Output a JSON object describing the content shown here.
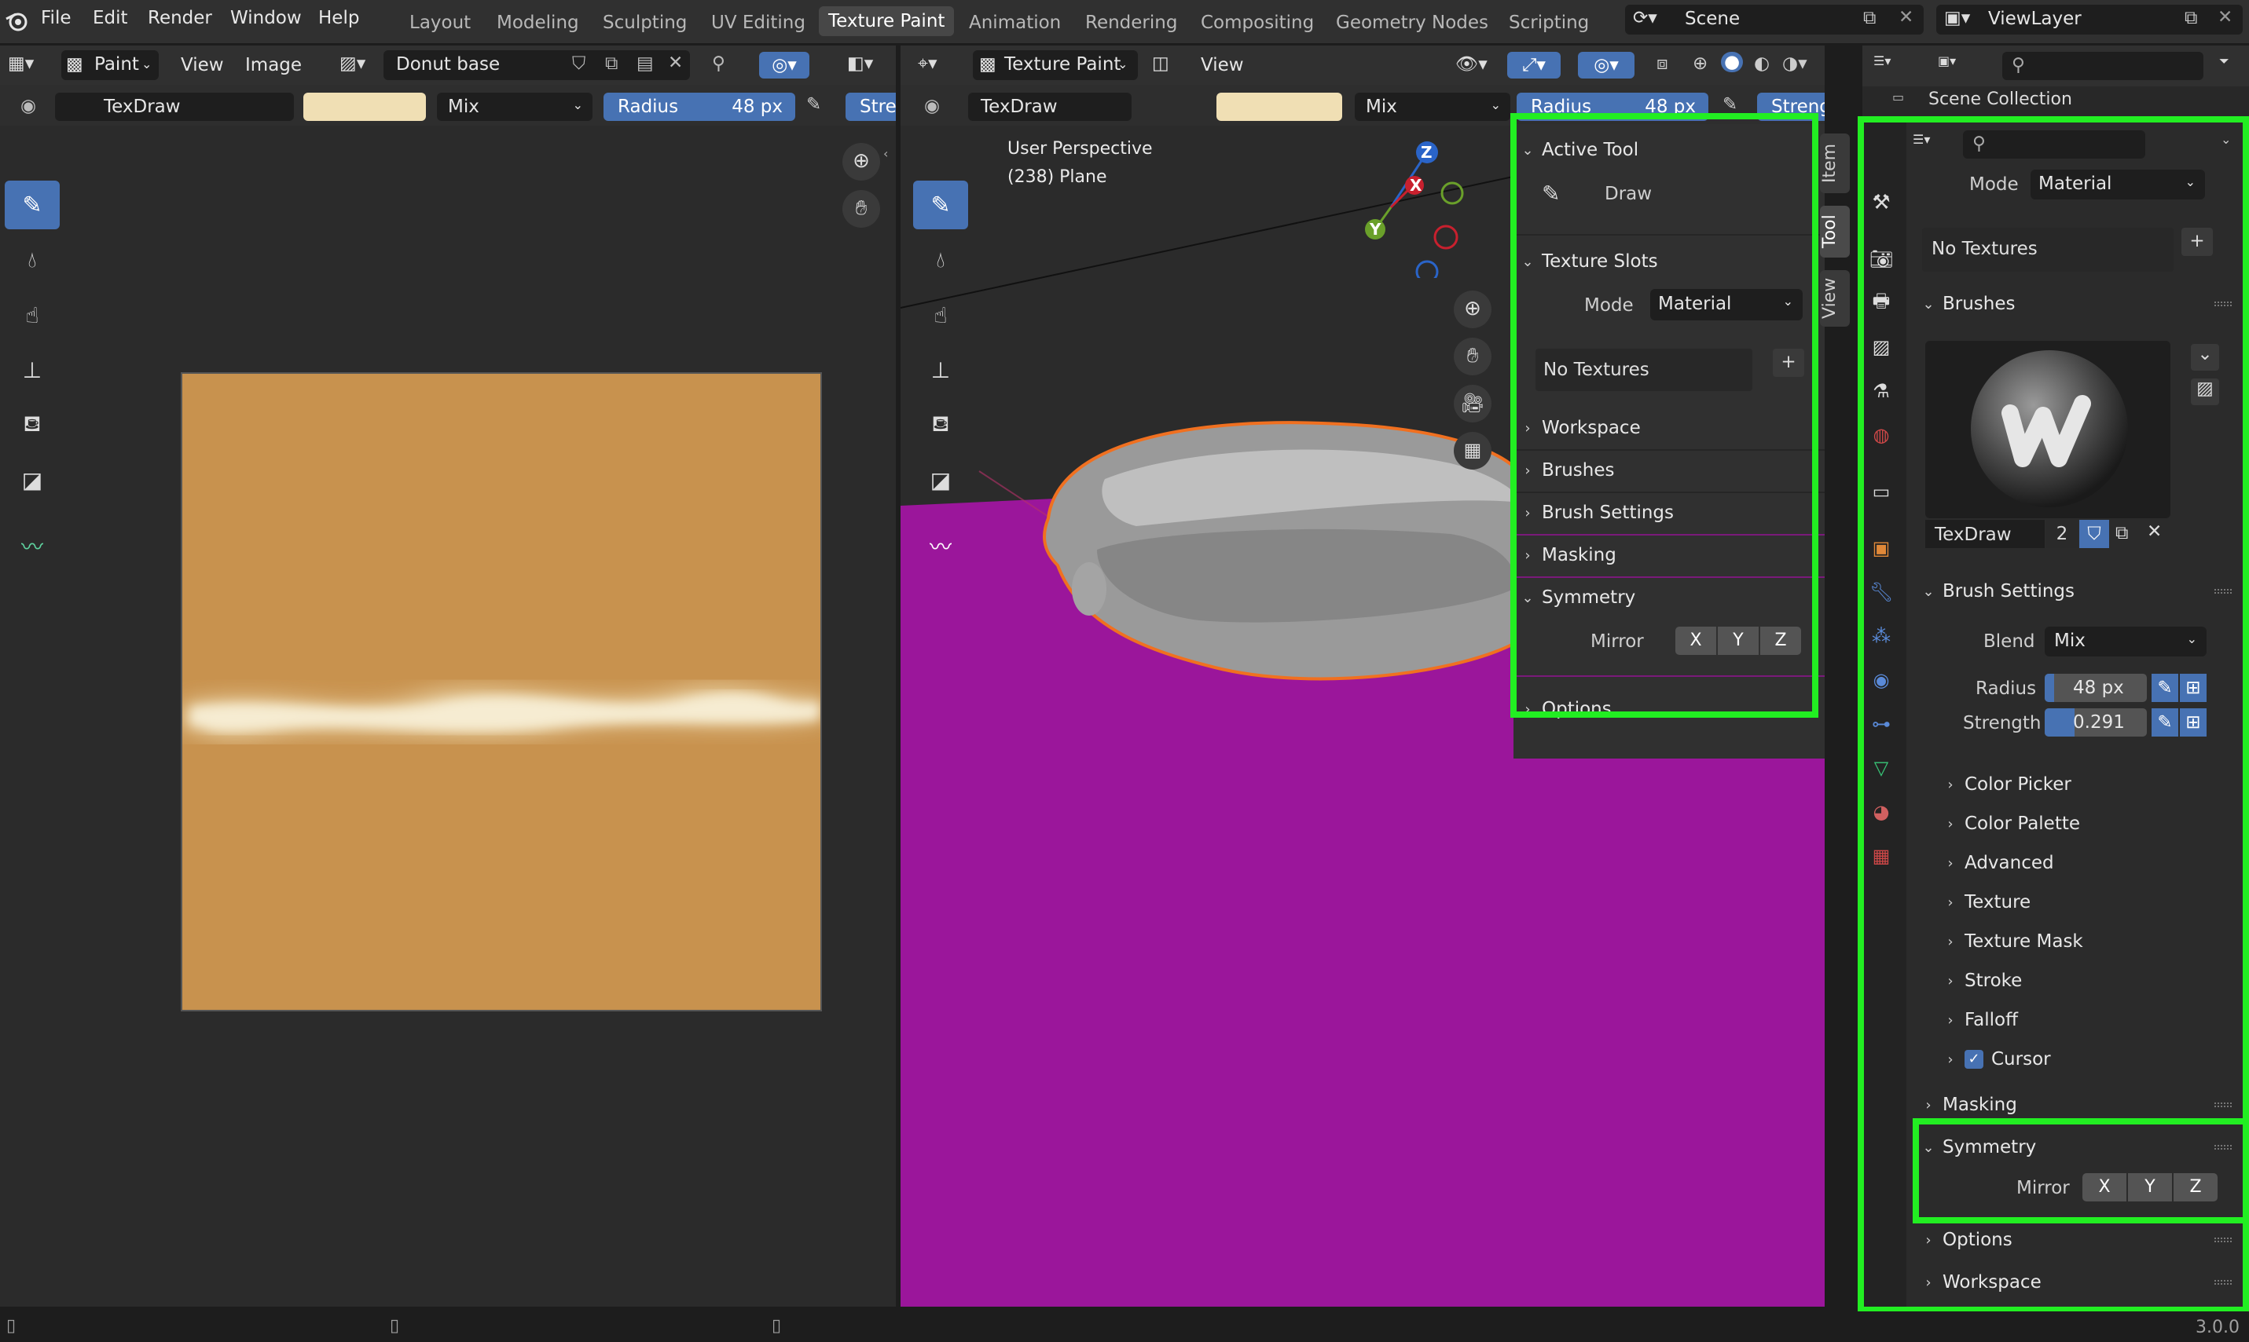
{
  "topbar": {
    "menus": [
      "File",
      "Edit",
      "Render",
      "Window",
      "Help"
    ],
    "workspaces": [
      "Layout",
      "Modeling",
      "Sculpting",
      "UV Editing",
      "Texture Paint",
      "Animation",
      "Rendering",
      "Compositing",
      "Geometry Nodes",
      "Scripting"
    ],
    "active_workspace": "Texture Paint",
    "scene": "Scene",
    "view_layer": "ViewLayer"
  },
  "image_editor": {
    "mode": "Paint",
    "menus": [
      "View",
      "Image"
    ],
    "image_name": "Donut base",
    "brush": "TexDraw",
    "blend": "Mix",
    "radius_label": "Radius",
    "radius_value": "48 px",
    "strength_label": "Stre",
    "canvas_color": "#c8924e",
    "stroke_color": "#f2e4c0"
  },
  "viewport": {
    "mode": "Texture Paint",
    "menus": [
      "View"
    ],
    "brush": "TexDraw",
    "blend": "Mix",
    "radius_label": "Radius",
    "radius_value": "48 px",
    "strength_label": "Strength",
    "perspective": "User Perspective",
    "object": "(238) Plane",
    "gizmo": {
      "x": "X",
      "y": "Y",
      "z": "Z"
    },
    "plane_color": "#9b169b",
    "tabs": [
      "Item",
      "Tool",
      "View"
    ]
  },
  "npanel": {
    "active_tool": {
      "title": "Active Tool",
      "tool": "Draw"
    },
    "texture_slots": {
      "title": "Texture Slots",
      "mode_label": "Mode",
      "mode_value": "Material",
      "no_textures": "No Textures",
      "add": "+"
    },
    "collapsed": [
      "Workspace",
      "Brushes",
      "Brush Settings",
      "Masking"
    ],
    "symmetry": {
      "title": "Symmetry",
      "mirror_label": "Mirror",
      "axes": [
        "X",
        "Y",
        "Z"
      ]
    },
    "options": "Options"
  },
  "outliner": {
    "title": "Scene Collection"
  },
  "properties": {
    "mode_label": "Mode",
    "mode_value": "Material",
    "no_textures": "No Textures",
    "add": "+",
    "brushes_title": "Brushes",
    "brush_name": "TexDraw",
    "brush_users": "2",
    "brush_settings_title": "Brush Settings",
    "blend_label": "Blend",
    "blend_value": "Mix",
    "radius_label": "Radius",
    "radius_value": "48 px",
    "strength_label": "Strength",
    "strength_value": "0.291",
    "subpanels": [
      "Color Picker",
      "Color Palette",
      "Advanced",
      "Texture",
      "Texture Mask",
      "Stroke",
      "Falloff"
    ],
    "cursor_label": "Cursor",
    "cursor_checked": true,
    "masking": "Masking",
    "symmetry_title": "Symmetry",
    "mirror_label": "Mirror",
    "axes": [
      "X",
      "Y",
      "Z"
    ],
    "options": "Options",
    "workspace": "Workspace"
  },
  "status": {
    "version": "3.0.0"
  },
  "colors": {
    "accent": "#4772b3",
    "highlight": "#22ee22",
    "object_outline": "#f07020"
  }
}
